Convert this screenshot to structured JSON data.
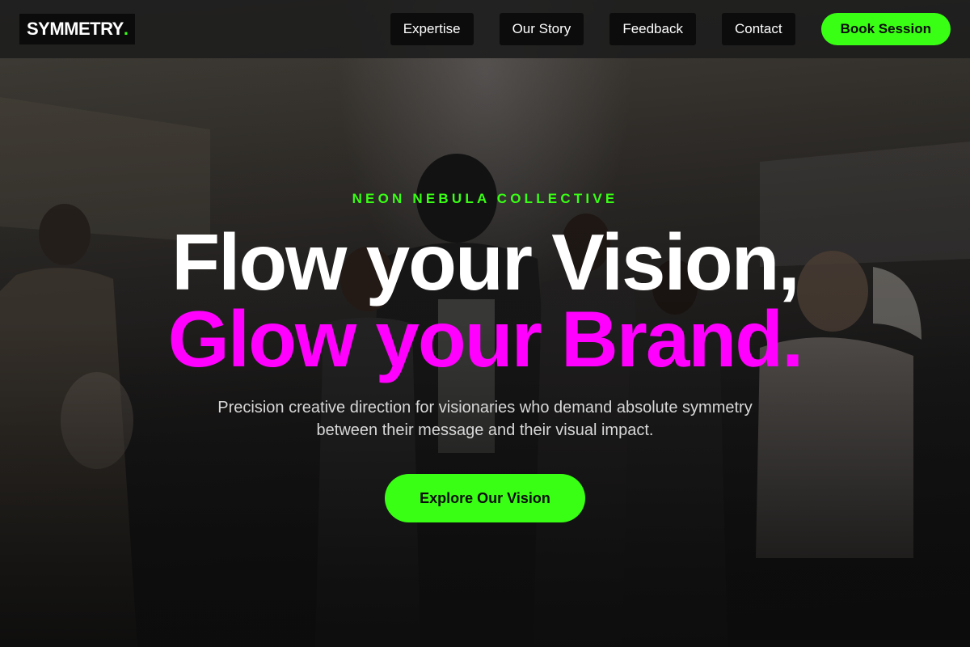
{
  "brand": {
    "logo_text": "SYMMETRY",
    "logo_dot": ".",
    "accent_color": "#39ff14",
    "highlight_color": "#ff00ff"
  },
  "nav": {
    "items": [
      {
        "label": "Expertise"
      },
      {
        "label": "Our Story"
      },
      {
        "label": "Feedback"
      },
      {
        "label": "Contact"
      }
    ],
    "cta_label": "Book Session"
  },
  "hero": {
    "eyebrow": "NEON NEBULA COLLECTIVE",
    "headline_line1": "Flow your Vision,",
    "headline_line2": "Glow your Brand.",
    "subtitle": "Precision creative direction for visionaries who demand absolute symmetry between their message and their visual impact.",
    "cta_label": "Explore Our Vision",
    "background_image": "dark-group-photo"
  }
}
